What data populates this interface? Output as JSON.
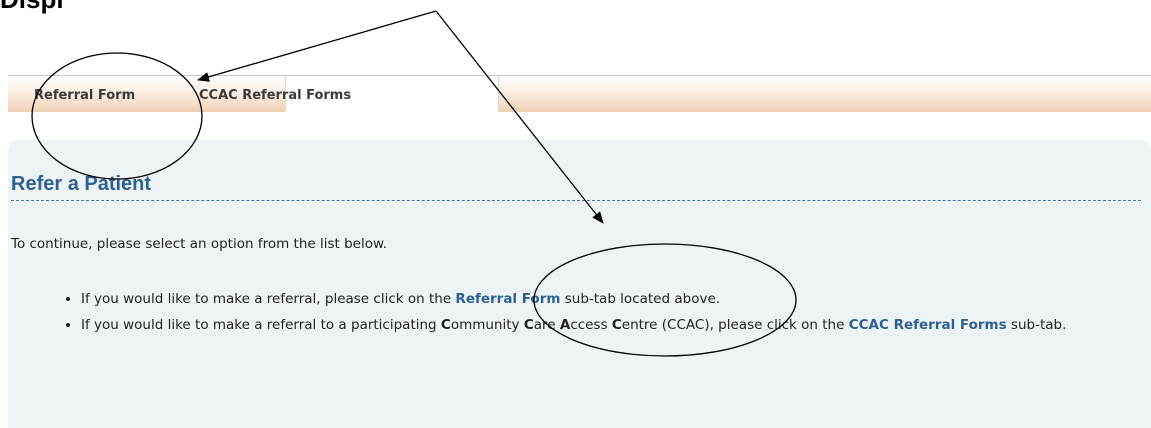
{
  "page_heading_cropped": "Displ",
  "subtabs": [
    {
      "label": "Referral Form"
    },
    {
      "label": "CCAC Referral Forms"
    }
  ],
  "panel": {
    "title": "Refer a Patient",
    "intro": "To continue, please select an option from the list below.",
    "bullet1": {
      "before": "If you would like to make a referral, please click on the ",
      "link": "Referral Form",
      "after": " sub-tab located above."
    },
    "bullet2": {
      "part1": "If you would like to make a referral to a participating ",
      "c1": "C",
      "w1": "ommunity ",
      "c2": "C",
      "w2": "are ",
      "a": "A",
      "w3": "ccess ",
      "c3": "C",
      "w4": "entre (CCAC), please click on the ",
      "link": "CCAC Referral Forms",
      "after": " sub-tab."
    }
  },
  "colors": {
    "accent_blue": "#2f6093",
    "panel_bg": "#eef4f6",
    "subtab_gradient": "#f5dcc6"
  }
}
